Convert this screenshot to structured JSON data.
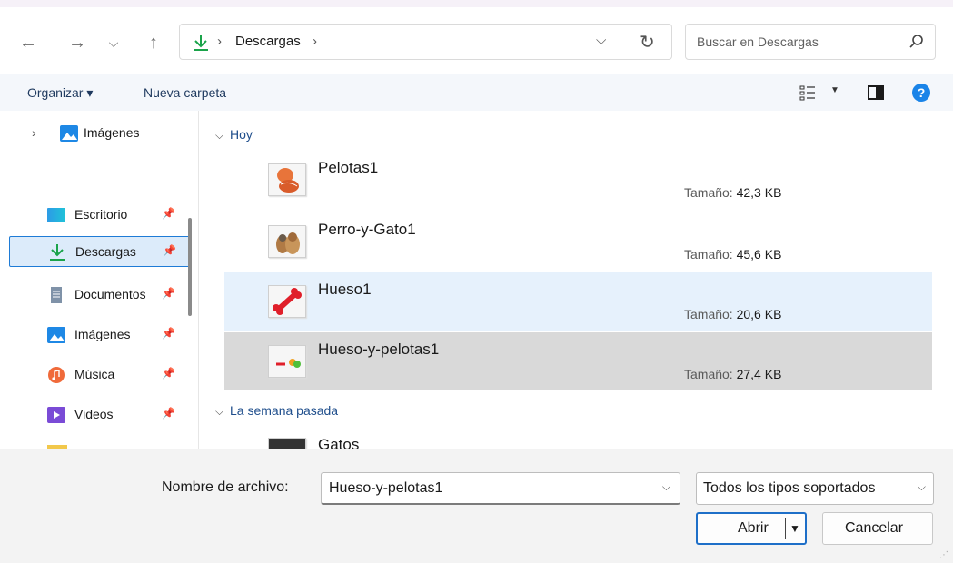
{
  "nav": {
    "address": {
      "location": "Descargas",
      "separator": "›"
    },
    "search": {
      "placeholder": "Buscar en Descargas"
    }
  },
  "commands": {
    "organize": "Organizar ▾",
    "new_folder": "Nueva carpeta"
  },
  "sidebar": {
    "expanded_item": "Imágenes",
    "items": [
      {
        "label": "Escritorio",
        "icon": "desktop-icon"
      },
      {
        "label": "Descargas",
        "icon": "download-icon",
        "selected": true
      },
      {
        "label": "Documentos",
        "icon": "document-icon"
      },
      {
        "label": "Imágenes",
        "icon": "pictures-icon"
      },
      {
        "label": "Música",
        "icon": "music-icon"
      },
      {
        "label": "Videos",
        "icon": "video-icon"
      }
    ]
  },
  "file_list": {
    "groups": [
      {
        "header": "Hoy",
        "files": [
          {
            "name": "Pelotas1",
            "size_label": "Tamaño:",
            "size": "42,3 KB"
          },
          {
            "name": "Perro-y-Gato1",
            "size_label": "Tamaño:",
            "size": "45,6 KB"
          },
          {
            "name": "Hueso1",
            "size_label": "Tamaño:",
            "size": "20,6 KB",
            "state": "hover"
          },
          {
            "name": "Hueso-y-pelotas1",
            "size_label": "Tamaño:",
            "size": "27,4 KB",
            "state": "selected"
          }
        ]
      },
      {
        "header": "La semana pasada",
        "files": [
          {
            "name": "Gatos"
          }
        ]
      }
    ]
  },
  "bottom": {
    "filename_label": "Nombre de archivo:",
    "filename_value": "Hueso-y-pelotas1",
    "filetype_value": "Todos los tipos soportados",
    "open_label": "Abrir",
    "cancel_label": "Cancelar"
  },
  "colors": {
    "accent": "#1e7bd6",
    "selected_row": "#d9d9d9",
    "hover_row": "#e6f1fc",
    "help": "#1a84e8"
  }
}
